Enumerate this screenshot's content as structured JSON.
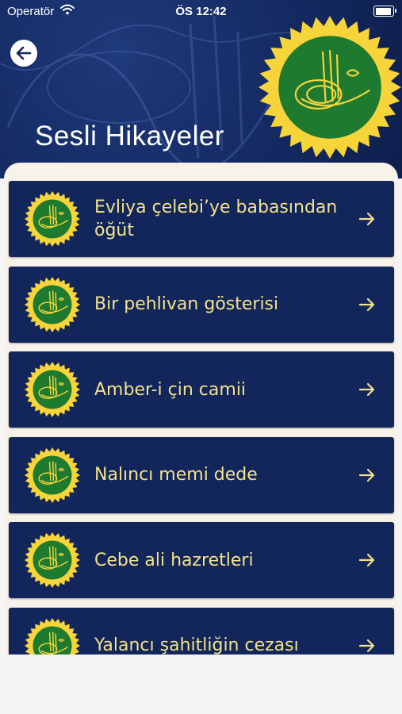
{
  "status_bar": {
    "carrier": "Operatör",
    "time": "ÖS 12:42",
    "battery_level": 1.0
  },
  "header": {
    "title": "Sesli Hikayeler"
  },
  "colors": {
    "header_bg": "#142a63",
    "card_bg": "#13265b",
    "card_text": "#f2e28a",
    "seal_green": "#1e7a2e",
    "seal_gold": "#f4c82a"
  },
  "icons": {
    "back": "arrow-left-circle-icon",
    "item_arrow": "arrow-right-icon",
    "seal": "tughra-seal-icon"
  },
  "stories": [
    {
      "label": "Evliya çelebi’ye babasından öğüt"
    },
    {
      "label": "Bir pehlivan gösterisi"
    },
    {
      "label": "Amber-i çin camii"
    },
    {
      "label": "Nalıncı memi dede"
    },
    {
      "label": "Cebe ali hazretleri"
    },
    {
      "label": "Yalancı şahitliğin cezası"
    }
  ]
}
